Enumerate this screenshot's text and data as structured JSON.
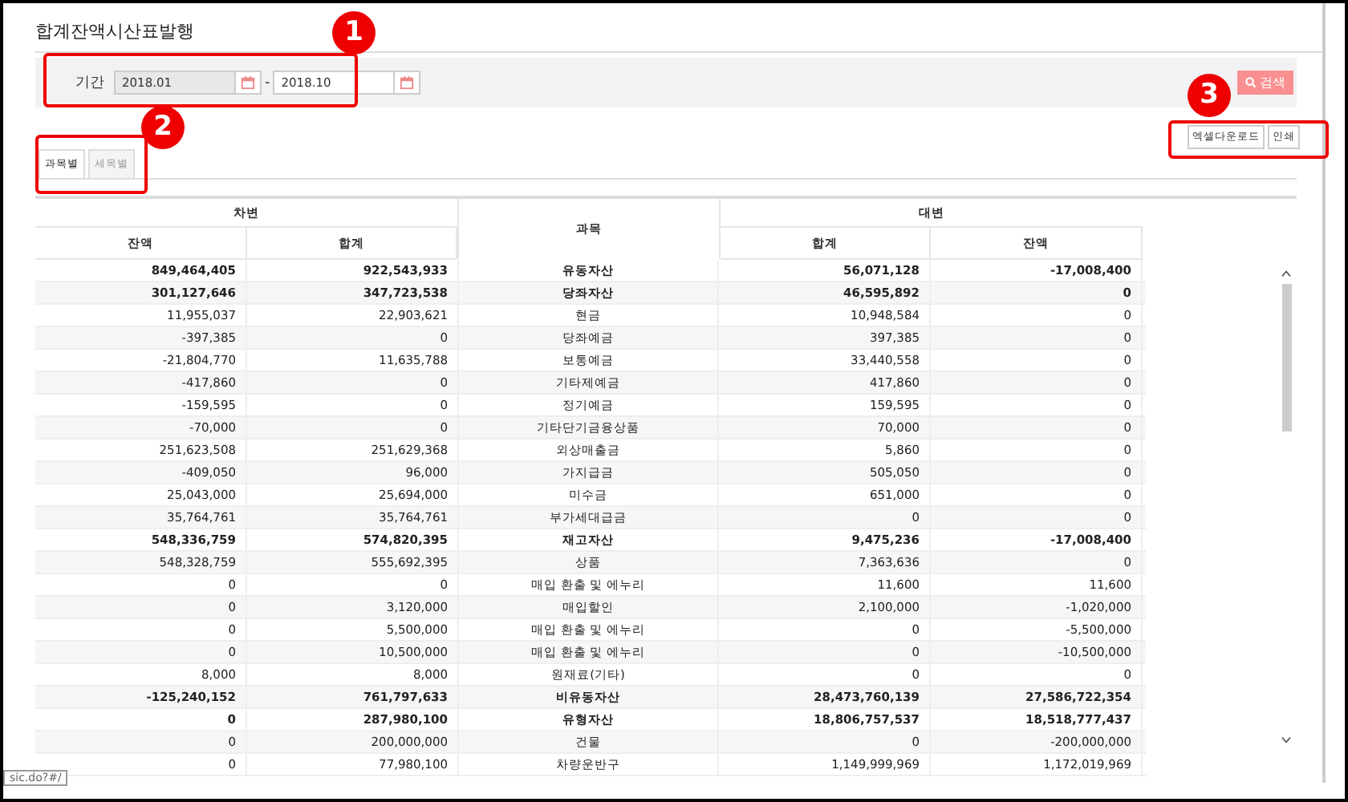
{
  "page_title": "합계잔액시산표발행",
  "search": {
    "label": "기간",
    "from": "2018.01",
    "to": "2018.10",
    "separator": "-",
    "button": "검색"
  },
  "actions": [
    "엑셀다운로드",
    "인쇄"
  ],
  "tabs": [
    {
      "label": "과목별",
      "selected": true
    },
    {
      "label": "세목별",
      "selected": false
    }
  ],
  "table": {
    "group_debit": "차변",
    "group_account": "과목",
    "group_credit": "대변",
    "columns": [
      "잔액",
      "합계",
      "합계",
      "잔액"
    ],
    "rows": [
      {
        "cells": [
          "849,464,405",
          "922,543,933",
          "유동자산",
          "56,071,128",
          "-17,008,400"
        ],
        "bold": true
      },
      {
        "cells": [
          "301,127,646",
          "347,723,538",
          "당좌자산",
          "46,595,892",
          "0"
        ],
        "bold": true
      },
      {
        "cells": [
          "11,955,037",
          "22,903,621",
          "현금",
          "10,948,584",
          "0"
        ],
        "bold": false
      },
      {
        "cells": [
          "-397,385",
          "0",
          "당좌예금",
          "397,385",
          "0"
        ],
        "bold": false
      },
      {
        "cells": [
          "-21,804,770",
          "11,635,788",
          "보통예금",
          "33,440,558",
          "0"
        ],
        "bold": false
      },
      {
        "cells": [
          "-417,860",
          "0",
          "기타제예금",
          "417,860",
          "0"
        ],
        "bold": false
      },
      {
        "cells": [
          "-159,595",
          "0",
          "정기예금",
          "159,595",
          "0"
        ],
        "bold": false
      },
      {
        "cells": [
          "-70,000",
          "0",
          "기타단기금융상품",
          "70,000",
          "0"
        ],
        "bold": false
      },
      {
        "cells": [
          "251,623,508",
          "251,629,368",
          "외상매출금",
          "5,860",
          "0"
        ],
        "bold": false
      },
      {
        "cells": [
          "-409,050",
          "96,000",
          "가지급금",
          "505,050",
          "0"
        ],
        "bold": false
      },
      {
        "cells": [
          "25,043,000",
          "25,694,000",
          "미수금",
          "651,000",
          "0"
        ],
        "bold": false
      },
      {
        "cells": [
          "35,764,761",
          "35,764,761",
          "부가세대급금",
          "0",
          "0"
        ],
        "bold": false
      },
      {
        "cells": [
          "548,336,759",
          "574,820,395",
          "재고자산",
          "9,475,236",
          "-17,008,400"
        ],
        "bold": true
      },
      {
        "cells": [
          "548,328,759",
          "555,692,395",
          "상품",
          "7,363,636",
          "0"
        ],
        "bold": false
      },
      {
        "cells": [
          "0",
          "0",
          "매입 환출 및 에누리",
          "11,600",
          "11,600"
        ],
        "bold": false
      },
      {
        "cells": [
          "0",
          "3,120,000",
          "매입할인",
          "2,100,000",
          "-1,020,000"
        ],
        "bold": false
      },
      {
        "cells": [
          "0",
          "5,500,000",
          "매입 환출 및 에누리",
          "0",
          "-5,500,000"
        ],
        "bold": false
      },
      {
        "cells": [
          "0",
          "10,500,000",
          "매입 환출 및 에누리",
          "0",
          "-10,500,000"
        ],
        "bold": false
      },
      {
        "cells": [
          "8,000",
          "8,000",
          "원재료(기타)",
          "0",
          "0"
        ],
        "bold": false
      },
      {
        "cells": [
          "-125,240,152",
          "761,797,633",
          "비유동자산",
          "28,473,760,139",
          "27,586,722,354"
        ],
        "bold": true
      },
      {
        "cells": [
          "0",
          "287,980,100",
          "유형자산",
          "18,806,757,537",
          "18,518,777,437"
        ],
        "bold": true
      },
      {
        "cells": [
          "0",
          "200,000,000",
          "건물",
          "0",
          "-200,000,000"
        ],
        "bold": false
      },
      {
        "cells": [
          "0",
          "77,980,100",
          "차량운반구",
          "1,149,999,969",
          "1,172,019,969"
        ],
        "bold": false
      }
    ]
  },
  "status_url": "sic.do?#/",
  "callouts": [
    "1",
    "2",
    "3"
  ]
}
